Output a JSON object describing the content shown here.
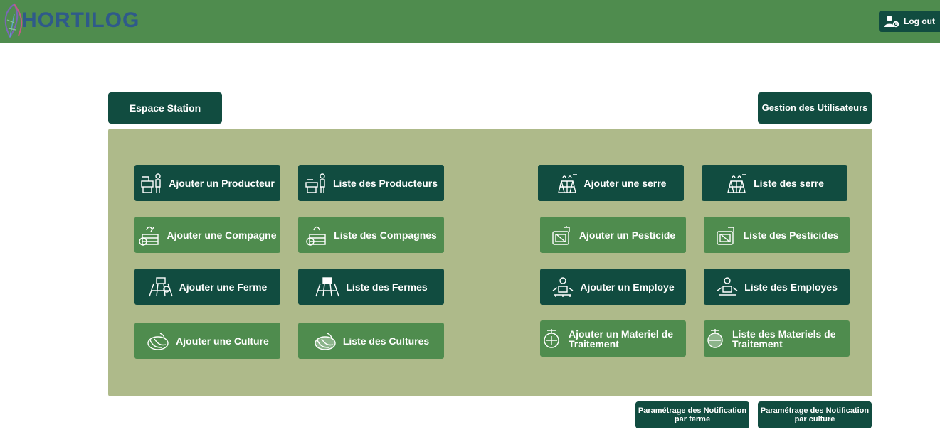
{
  "header": {
    "logo_text": "HORTILOG",
    "logout_label": "Log out",
    "bar_color": "#4f8c4e"
  },
  "actions": {
    "espace_station": "Espace Station",
    "gestion_utilisateurs": "Gestion des Utilisateurs",
    "notif_ferme": "Paramétrage des Notification par ferme",
    "notif_culture": "Paramétrage des Notification par culture"
  },
  "tiles": {
    "ajouter_producteur": {
      "label": "Ajouter un Producteur",
      "icon": "farmer-icon"
    },
    "liste_producteurs": {
      "label": "Liste des Producteurs",
      "icon": "farmer-icon"
    },
    "ajouter_serre": {
      "label": "Ajouter une serre",
      "icon": "greenhouse-icon"
    },
    "liste_serre": {
      "label": "Liste des serre",
      "icon": "greenhouse-icon"
    },
    "ajouter_compagne": {
      "label": "Ajouter une Compagne",
      "icon": "harvest-basket-icon"
    },
    "liste_compagnes": {
      "label": "Liste des Compagnes",
      "icon": "harvest-basket-icon"
    },
    "ajouter_pesticide": {
      "label": "Ajouter un Pesticide",
      "icon": "pesticide-icon"
    },
    "liste_pesticides": {
      "label": "Liste des Pesticides",
      "icon": "pesticide-icon"
    },
    "ajouter_ferme": {
      "label": "Ajouter une Ferme",
      "icon": "tractor-field-icon"
    },
    "liste_fermes": {
      "label": "Liste des Fermes",
      "icon": "tractor-field-icon"
    },
    "ajouter_employe": {
      "label": "Ajouter un Employe",
      "icon": "worker-icon"
    },
    "liste_employes": {
      "label": "Liste des Employes",
      "icon": "worker-icon"
    },
    "ajouter_culture": {
      "label": "Ajouter une Culture",
      "icon": "crop-icon"
    },
    "liste_cultures": {
      "label": "Liste des Cultures",
      "icon": "crop-icon"
    },
    "ajouter_materiel": {
      "label": "Ajouter un Materiel de Traitement",
      "icon": "treatment-equipment-icon"
    },
    "liste_materiels": {
      "label": "Liste des Materiels de Traitement",
      "icon": "treatment-equipment-icon"
    }
  },
  "colors": {
    "dark_green": "#114c40",
    "mid_green": "#4f8c4e",
    "panel": "#aeba8a"
  }
}
